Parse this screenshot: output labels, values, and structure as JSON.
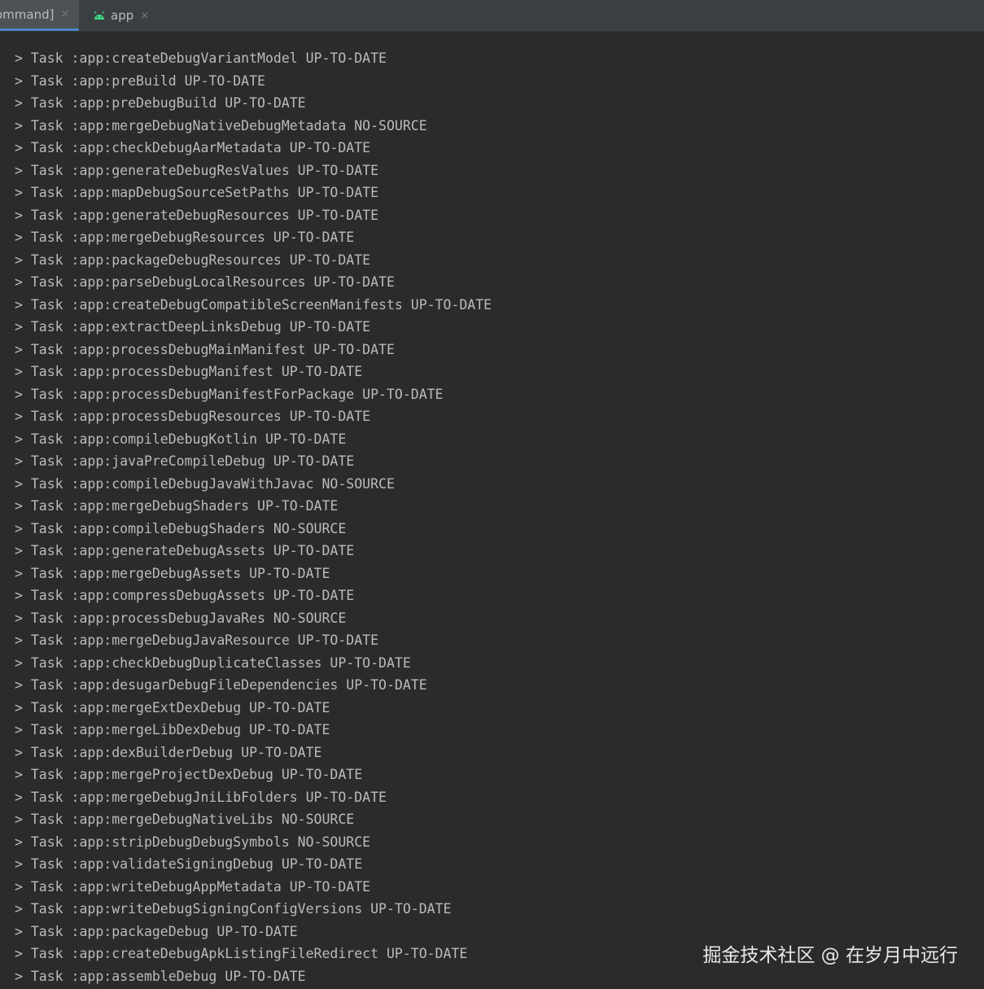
{
  "tabs": [
    {
      "label": "ommand]",
      "active": true
    },
    {
      "label": "app",
      "active": false
    }
  ],
  "close_glyph": "×",
  "colors": {
    "background": "#2b2b2b",
    "text": "#bbbbbb",
    "tab_active_underline": "#4a88c7",
    "android_icon": "#3ddc84"
  },
  "console": {
    "lines": [
      "> Task :app:createDebugVariantModel UP-TO-DATE",
      "> Task :app:preBuild UP-TO-DATE",
      "> Task :app:preDebugBuild UP-TO-DATE",
      "> Task :app:mergeDebugNativeDebugMetadata NO-SOURCE",
      "> Task :app:checkDebugAarMetadata UP-TO-DATE",
      "> Task :app:generateDebugResValues UP-TO-DATE",
      "> Task :app:mapDebugSourceSetPaths UP-TO-DATE",
      "> Task :app:generateDebugResources UP-TO-DATE",
      "> Task :app:mergeDebugResources UP-TO-DATE",
      "> Task :app:packageDebugResources UP-TO-DATE",
      "> Task :app:parseDebugLocalResources UP-TO-DATE",
      "> Task :app:createDebugCompatibleScreenManifests UP-TO-DATE",
      "> Task :app:extractDeepLinksDebug UP-TO-DATE",
      "> Task :app:processDebugMainManifest UP-TO-DATE",
      "> Task :app:processDebugManifest UP-TO-DATE",
      "> Task :app:processDebugManifestForPackage UP-TO-DATE",
      "> Task :app:processDebugResources UP-TO-DATE",
      "> Task :app:compileDebugKotlin UP-TO-DATE",
      "> Task :app:javaPreCompileDebug UP-TO-DATE",
      "> Task :app:compileDebugJavaWithJavac NO-SOURCE",
      "> Task :app:mergeDebugShaders UP-TO-DATE",
      "> Task :app:compileDebugShaders NO-SOURCE",
      "> Task :app:generateDebugAssets UP-TO-DATE",
      "> Task :app:mergeDebugAssets UP-TO-DATE",
      "> Task :app:compressDebugAssets UP-TO-DATE",
      "> Task :app:processDebugJavaRes NO-SOURCE",
      "> Task :app:mergeDebugJavaResource UP-TO-DATE",
      "> Task :app:checkDebugDuplicateClasses UP-TO-DATE",
      "> Task :app:desugarDebugFileDependencies UP-TO-DATE",
      "> Task :app:mergeExtDexDebug UP-TO-DATE",
      "> Task :app:mergeLibDexDebug UP-TO-DATE",
      "> Task :app:dexBuilderDebug UP-TO-DATE",
      "> Task :app:mergeProjectDexDebug UP-TO-DATE",
      "> Task :app:mergeDebugJniLibFolders UP-TO-DATE",
      "> Task :app:mergeDebugNativeLibs NO-SOURCE",
      "> Task :app:stripDebugDebugSymbols NO-SOURCE",
      "> Task :app:validateSigningDebug UP-TO-DATE",
      "> Task :app:writeDebugAppMetadata UP-TO-DATE",
      "> Task :app:writeDebugSigningConfigVersions UP-TO-DATE",
      "> Task :app:packageDebug UP-TO-DATE",
      "> Task :app:createDebugApkListingFileRedirect UP-TO-DATE",
      "> Task :app:assembleDebug UP-TO-DATE"
    ]
  },
  "watermark": "掘金技术社区 @ 在岁月中远行"
}
